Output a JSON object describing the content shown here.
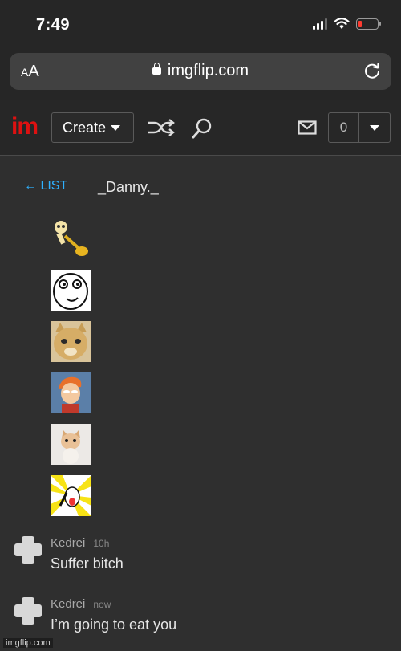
{
  "status_bar": {
    "time": "7:49"
  },
  "browser": {
    "aa_small": "A",
    "aa_large": "A",
    "url": "imgflip.com"
  },
  "header": {
    "logo_i": "i",
    "logo_m": "m",
    "create_label": "Create",
    "notification_count": "0"
  },
  "page": {
    "list_label": "← LIST",
    "username": "_Danny._"
  },
  "thumbnails": [
    {
      "name": "skeleton-trumpet-image"
    },
    {
      "name": "derp-face-image"
    },
    {
      "name": "smiling-cat-image"
    },
    {
      "name": "futurama-fry-image"
    },
    {
      "name": "kitten-image"
    },
    {
      "name": "x-all-the-y-image"
    }
  ],
  "comments": [
    {
      "user": "Kedrei",
      "time": "10h",
      "text": "Suffer bitch"
    },
    {
      "user": "Kedrei",
      "time": "now",
      "text": "I’m going to eat you"
    }
  ],
  "watermark": "imgflip.com",
  "colors": {
    "accent_link": "#2fb1ff",
    "brand_red": "#dd1111",
    "battery_low": "#ff3b30"
  }
}
